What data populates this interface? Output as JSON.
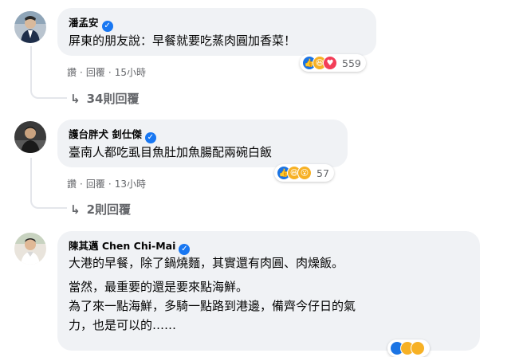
{
  "colors": {
    "bubble_bg": "#f0f2f5",
    "meta_text": "#65676b",
    "verified_blue": "#1877f2",
    "thread_line": "#e4e6eb"
  },
  "comments": [
    {
      "author": "潘孟安",
      "verified": true,
      "text": "屏東的朋友說：早餐就要吃蒸肉圓加香菜！",
      "reactions": [
        "like-icon",
        "haha-icon",
        "love-icon"
      ],
      "reaction_count": "559",
      "actions": {
        "like": "讚",
        "reply": "回覆",
        "time": "15小時"
      },
      "replies_label": "34則回覆"
    },
    {
      "author": "護台胖犬 釗仕傑",
      "verified": true,
      "text": "臺南人都吃虱目魚肚加魚腸配兩碗白飯",
      "reactions": [
        "like-icon",
        "haha-icon",
        "wow-icon"
      ],
      "reaction_count": "57",
      "actions": {
        "like": "讚",
        "reply": "回覆",
        "time": "13小時"
      },
      "replies_label": "2則回覆"
    },
    {
      "author": "陳其邁 Chen Chi-Mai",
      "verified": true,
      "lines": [
        "大港的早餐，除了鍋燒麵，其實還有肉圓、肉燥飯。",
        "當然，最重要的還是要來點海鮮。",
        "為了來一點海鮮，多騎一點路到港邊，備齊今仔日的氣",
        "力，也是可以的……"
      ]
    }
  ]
}
